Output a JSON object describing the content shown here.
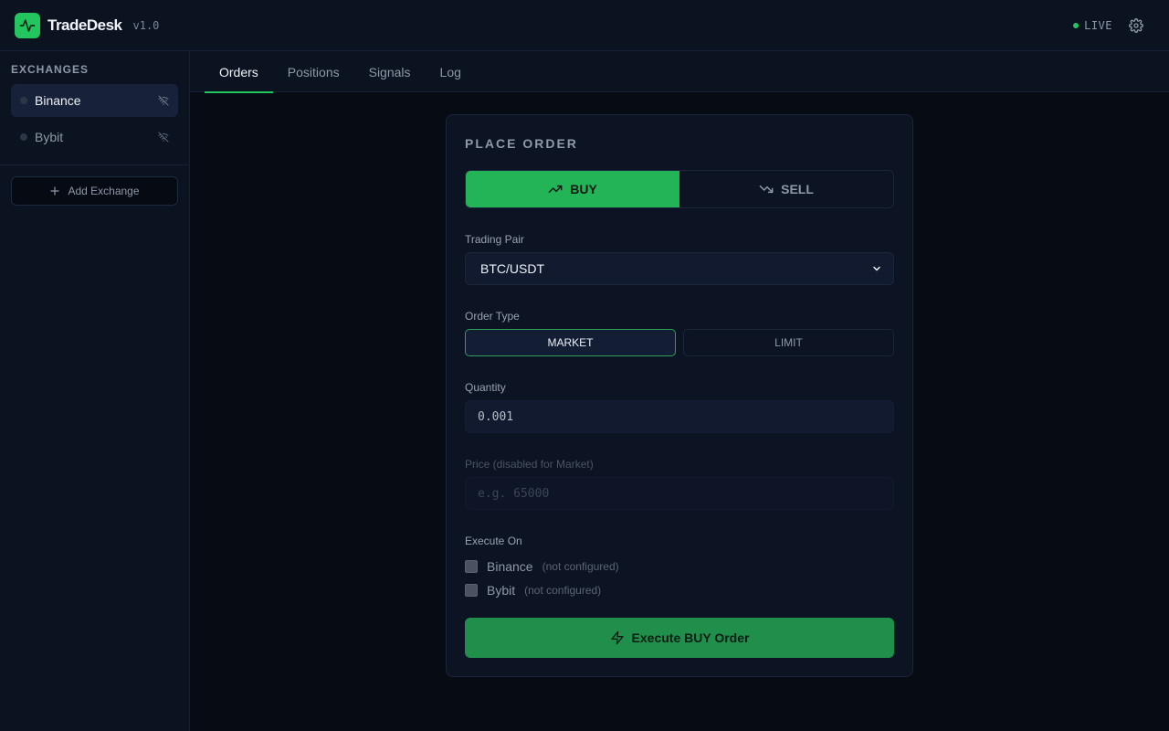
{
  "app": {
    "name": "TradeDesk",
    "version": "v1.0",
    "status": "LIVE",
    "colors": {
      "accent": "#22c55e",
      "background": "#070b14",
      "panel": "#0b1220"
    }
  },
  "sidebar": {
    "heading": "EXCHANGES",
    "items": [
      {
        "label": "Binance",
        "icon": "wifi-off-icon",
        "active": true
      },
      {
        "label": "Bybit",
        "icon": "wifi-off-icon",
        "active": false
      }
    ],
    "add_label": "Add Exchange"
  },
  "tabs": [
    {
      "label": "Orders",
      "active": true
    },
    {
      "label": "Positions",
      "active": false
    },
    {
      "label": "Signals",
      "active": false
    },
    {
      "label": "Log",
      "active": false
    }
  ],
  "order": {
    "title": "PLACE ORDER",
    "side": {
      "buy_label": "BUY",
      "sell_label": "SELL",
      "selected": "BUY"
    },
    "pair": {
      "label": "Trading Pair",
      "value": "BTC/USDT"
    },
    "type": {
      "label": "Order Type",
      "market_label": "MARKET",
      "limit_label": "LIMIT",
      "selected": "MARKET"
    },
    "quantity": {
      "label": "Quantity",
      "value": "0.001"
    },
    "price": {
      "label": "Price (disabled for Market)",
      "placeholder": "e.g. 65000"
    },
    "execute_on": {
      "label": "Execute On",
      "exchanges": [
        {
          "name": "Binance",
          "note": "(not configured)"
        },
        {
          "name": "Bybit",
          "note": "(not configured)"
        }
      ]
    },
    "execute_label": "Execute BUY Order"
  }
}
